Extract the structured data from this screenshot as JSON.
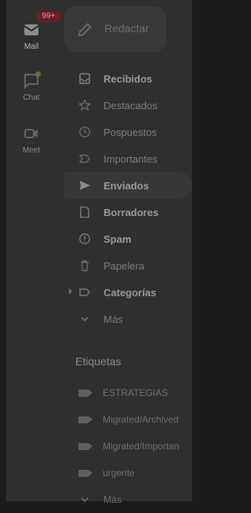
{
  "rail": {
    "items": [
      {
        "label": "Mail",
        "badge": "99+",
        "icon": "mail-icon",
        "active": true
      },
      {
        "label": "Chat",
        "icon": "chat-icon",
        "has_dot": true
      },
      {
        "label": "Meet",
        "icon": "video-icon"
      }
    ]
  },
  "compose": {
    "label": "Redactar",
    "icon": "pencil-icon"
  },
  "nav": {
    "items": [
      {
        "label": "Recibidos",
        "icon": "inbox-icon",
        "bold": true
      },
      {
        "label": "Destacados",
        "icon": "star-icon"
      },
      {
        "label": "Pospuestos",
        "icon": "clock-icon"
      },
      {
        "label": "Importantes",
        "icon": "important-icon"
      },
      {
        "label": "Enviados",
        "icon": "send-icon",
        "bold": true,
        "selected": true
      },
      {
        "label": "Borradores",
        "icon": "draft-icon",
        "bold": true
      },
      {
        "label": "Spam",
        "icon": "spam-icon",
        "bold": true
      },
      {
        "label": "Papelera",
        "icon": "trash-icon"
      },
      {
        "label": "Categorías",
        "icon": "label-icon",
        "bold": true,
        "expandable": true
      },
      {
        "label": "Más",
        "icon": "chevron-down-icon"
      }
    ]
  },
  "labels_section": {
    "title": "Etiquetas",
    "items": [
      {
        "label": "ESTRATEGIAS"
      },
      {
        "label": "Migrated/Archived"
      },
      {
        "label": "Migrated/Importan"
      },
      {
        "label": "urgente"
      },
      {
        "label": "Más"
      }
    ]
  },
  "colors": {
    "panel": "#2f2f2f",
    "backdrop": "#1b1b1b",
    "badge": "#6b1f1f",
    "chat_dot": "#7a6620"
  }
}
